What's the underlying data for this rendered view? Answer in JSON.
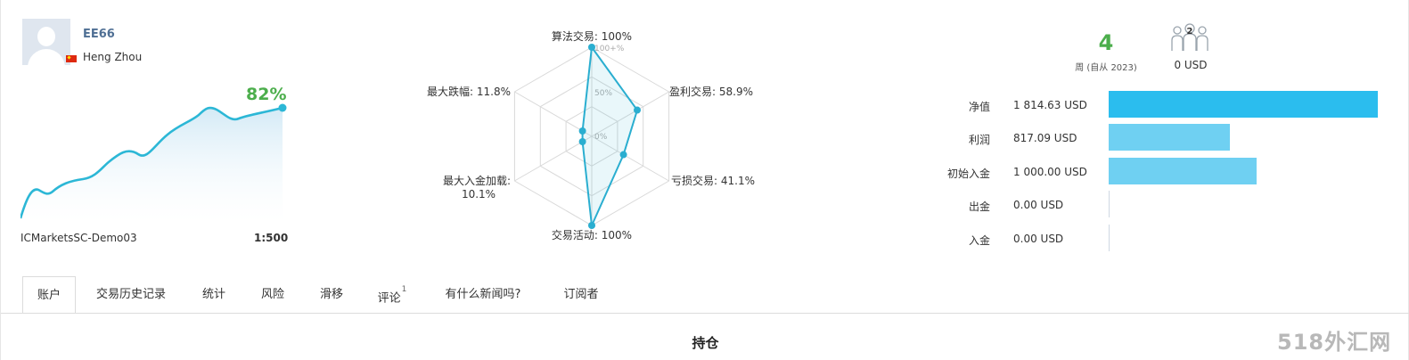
{
  "profile": {
    "username": "EE66",
    "real_name": "Heng Zhou",
    "growth_percent": "82%",
    "server": "ICMarketsSC-Demo03",
    "leverage": "1:500"
  },
  "radar": {
    "labels": {
      "algo": "算法交易: 100%",
      "profit_trades": "盈利交易: 58.9%",
      "loss_trades": "亏损交易: 41.1%",
      "activity": "交易活动: 100%",
      "max_deposit_load_line1": "最大入金加载:",
      "max_deposit_load_line2": "10.1%",
      "max_drawdown": "最大跌幅: 11.8%"
    },
    "scale": {
      "max": "100+%",
      "mid": "50%",
      "min": "0%"
    },
    "values": {
      "algo": 100,
      "profit_trades": 58.9,
      "loss_trades": 41.1,
      "activity": 100,
      "max_deposit_load": 10.1,
      "max_drawdown": 11.8
    }
  },
  "stats": {
    "weeks": "4",
    "weeks_label": "周 (自从 2023)",
    "subscribers": "2",
    "subscribers_funds": "0 USD"
  },
  "balances": [
    {
      "label": "净值",
      "value": "1 814.63 USD",
      "fraction": 1.0
    },
    {
      "label": "利润",
      "value": "817.09 USD",
      "fraction": 0.45
    },
    {
      "label": "初始入金",
      "value": "1 000.00 USD",
      "fraction": 0.551
    },
    {
      "label": "出金",
      "value": "0.00 USD",
      "fraction": 0
    },
    {
      "label": "入金",
      "value": "0.00 USD",
      "fraction": 0
    }
  ],
  "colors": {
    "equity_bar": "#2bbdee",
    "other_bar": "#6fd0f2",
    "growth_line": "#2cb7d6",
    "radar_line": "#2aaed0",
    "positive": "#4cae4c"
  },
  "tabs": [
    {
      "label": "账户",
      "active": true
    },
    {
      "label": "交易历史记录"
    },
    {
      "label": "统计"
    },
    {
      "label": "风险"
    },
    {
      "label": "滑移"
    },
    {
      "label": "评论",
      "badge": "1"
    },
    {
      "label": "有什么新闻吗?"
    },
    {
      "label": "订阅者"
    }
  ],
  "section_title": "持仓",
  "watermark": "518外汇网"
}
